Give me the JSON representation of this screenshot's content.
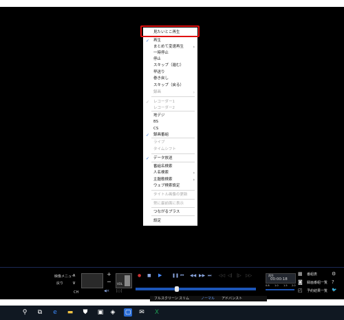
{
  "context_menu": {
    "items": [
      {
        "label": "見たいとこ再生",
        "state": "normal",
        "check": "",
        "submenu": false
      },
      {
        "label": "再生",
        "state": "normal",
        "check": "✓",
        "submenu": false
      },
      {
        "label": "まとめて変速再生",
        "state": "normal",
        "check": "",
        "submenu": true
      },
      {
        "label": "一時停止",
        "state": "normal",
        "check": "",
        "submenu": false
      },
      {
        "label": "停止",
        "state": "normal",
        "check": "",
        "submenu": false
      },
      {
        "label": "スキップ（進む）",
        "state": "normal",
        "check": "",
        "submenu": false
      },
      {
        "label": "早送り",
        "state": "normal",
        "check": "",
        "submenu": false
      },
      {
        "label": "巻き戻し",
        "state": "normal",
        "check": "",
        "submenu": false
      },
      {
        "label": "スキップ（戻る）",
        "state": "normal",
        "check": "",
        "submenu": false
      },
      {
        "label": "録画",
        "state": "disabled",
        "check": "",
        "submenu": true
      },
      {
        "label": "レコーダー1",
        "state": "disabled",
        "check": "✓",
        "submenu": false
      },
      {
        "label": "レコーダー2",
        "state": "disabled",
        "check": "",
        "submenu": false
      },
      {
        "label": "地デジ",
        "state": "normal",
        "check": "",
        "submenu": false
      },
      {
        "label": "BS",
        "state": "normal",
        "check": "",
        "submenu": false
      },
      {
        "label": "CS",
        "state": "normal",
        "check": "",
        "submenu": false
      },
      {
        "label": "録画番組",
        "state": "normal",
        "check": "✓",
        "submenu": false
      },
      {
        "label": "ライブ",
        "state": "disabled",
        "check": "",
        "submenu": false
      },
      {
        "label": "タイムシフト",
        "state": "disabled",
        "check": "",
        "submenu": false
      },
      {
        "label": "データ放送",
        "state": "normal",
        "check": "✓",
        "submenu": false
      },
      {
        "label": "番組名検索",
        "state": "normal",
        "check": "",
        "submenu": false
      },
      {
        "label": "人名検索",
        "state": "normal",
        "check": "",
        "submenu": true
      },
      {
        "label": "主題歌検索",
        "state": "normal",
        "check": "",
        "submenu": true
      },
      {
        "label": "ウェブ検索設定",
        "state": "normal",
        "check": "",
        "submenu": false
      },
      {
        "label": "タイトル画像の更新",
        "state": "disabled",
        "check": "",
        "submenu": false
      },
      {
        "label": "常に最前面に表示",
        "state": "disabled",
        "check": "",
        "submenu": false
      },
      {
        "label": "つながるプラス",
        "state": "normal",
        "check": "",
        "submenu": false
      },
      {
        "label": "設定",
        "state": "normal",
        "check": "",
        "submenu": false
      }
    ]
  },
  "controls": {
    "video_menu": "映像メニュー",
    "back": "戻り",
    "ch": "CH",
    "vol": "VOL",
    "clock_label": "再生",
    "clock_time": "00:00:18",
    "speeds": [
      "0.8",
      "1.0",
      "1.5",
      "2.0"
    ],
    "right_buttons": [
      {
        "icon": "grid-icon",
        "label": "番組表"
      },
      {
        "icon": "camera-icon",
        "label": "録画番組一覧"
      },
      {
        "icon": "calendar-icon",
        "label": "予約結果一覧"
      }
    ]
  },
  "modes": {
    "items": [
      {
        "label": "フルスクリーン",
        "selected": false
      },
      {
        "label": "スリム",
        "selected": false
      },
      {
        "label": "ノーマル",
        "selected": true
      },
      {
        "label": "アドバンスト",
        "selected": false
      }
    ]
  },
  "taskbar": {
    "icons": [
      "search-icon",
      "task-view-icon",
      "edge-icon",
      "folder-icon",
      "store-icon",
      "app-icon",
      "app-icon-2",
      "active-app-icon",
      "mail-icon",
      "excel-icon"
    ]
  },
  "colors": {
    "highlight_border": "#e01010",
    "accent": "#1d56b8",
    "checkmark": "#2a6cd4"
  }
}
